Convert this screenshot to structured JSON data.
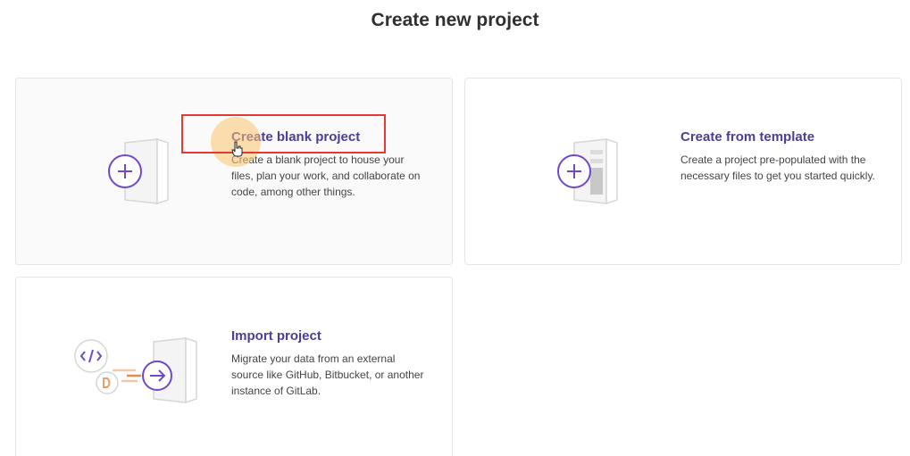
{
  "page": {
    "title": "Create new project"
  },
  "cards": {
    "blank": {
      "title": "Create blank project",
      "description": "Create a blank project to house your files, plan your work, and collaborate on code, among other things.",
      "icon": "plus-document-icon"
    },
    "template": {
      "title": "Create from template",
      "description": "Create a project pre-populated with the necessary files to get you started quickly.",
      "icon": "template-document-icon"
    },
    "import": {
      "title": "Import project",
      "description": "Migrate your data from an external source like GitHub, Bitbucket, or another instance of GitLab.",
      "icon": "import-document-icon"
    }
  },
  "colors": {
    "accent": "#6e49cb",
    "title_purple": "#4a3e97",
    "highlight_red": "#e53935",
    "import_orange": "#e9a06a"
  }
}
